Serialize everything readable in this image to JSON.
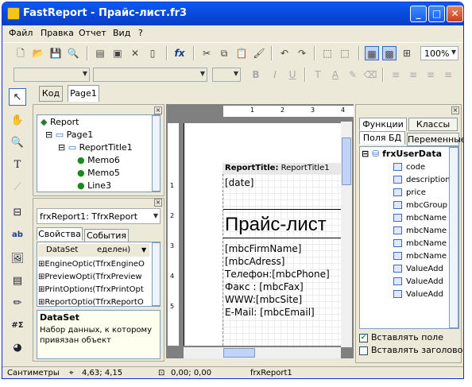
{
  "window": {
    "title": "FastReport - Прайс-лист.fr3",
    "min_label": "_",
    "max_label": "□",
    "close_label": "✕"
  },
  "menu": [
    "Файл",
    "Правка",
    "Отчет",
    "Вид",
    "?"
  ],
  "toolbar": {
    "zoom": "100%"
  },
  "tabs": {
    "code": "Код",
    "page": "Page1"
  },
  "tree": {
    "items": [
      "Report",
      "Page1",
      "ReportTitle1",
      "Memo6",
      "Memo5",
      "Line3"
    ]
  },
  "object_selector": "frxReport1: TfrxReport",
  "inspector": {
    "tabs": [
      "Свойства",
      "События"
    ],
    "rows": [
      {
        "name": "DataSet",
        "value": "еделен)"
      },
      {
        "name": "EngineOptions",
        "value": "(TfrxEngineO"
      },
      {
        "name": "PreviewOptions",
        "value": "(TfrxPreview"
      },
      {
        "name": "PrintOptions",
        "value": "(TfrxPrintOpt"
      },
      {
        "name": "ReportOptions",
        "value": "(TfrxReportO"
      }
    ],
    "desc_title": "DataSet",
    "desc_text": "Набор данных, к которому привязан объект"
  },
  "ruler": [
    "1",
    "2",
    "3",
    "4"
  ],
  "vruler": [
    "1",
    "2",
    "3",
    "4",
    "5"
  ],
  "band": {
    "label_bold": "ReportTitle:",
    "label": " ReportTitle1",
    "date": "[date]",
    "heading": "Прайс-лист",
    "lines": [
      "[mbcFirmName]",
      "[mbcAdress]",
      "Телефон:[mbcPhone]",
      "Факс : [mbcFax]",
      "WWW:[mbcSite]",
      "E-Mail: [mbcEmail]"
    ]
  },
  "right": {
    "tabs_top": [
      "Функции",
      "Классы"
    ],
    "tabs_bottom": [
      "Поля БД",
      "Переменные"
    ],
    "root": "frxUserData",
    "fields": [
      "code",
      "description",
      "price",
      "mbcGroup",
      "mbcName",
      "mbcName",
      "mbcName",
      "mbcName",
      "ValueAdd",
      "ValueAdd",
      "ValueAdd"
    ],
    "check_insert_field": "Вставлять поле",
    "check_insert_header": "Вставлять заголовок"
  },
  "status": {
    "units": "Сантиметры",
    "pos": "4,63; 4,15",
    "size": "0,00; 0,00",
    "object": "frxReport1"
  }
}
